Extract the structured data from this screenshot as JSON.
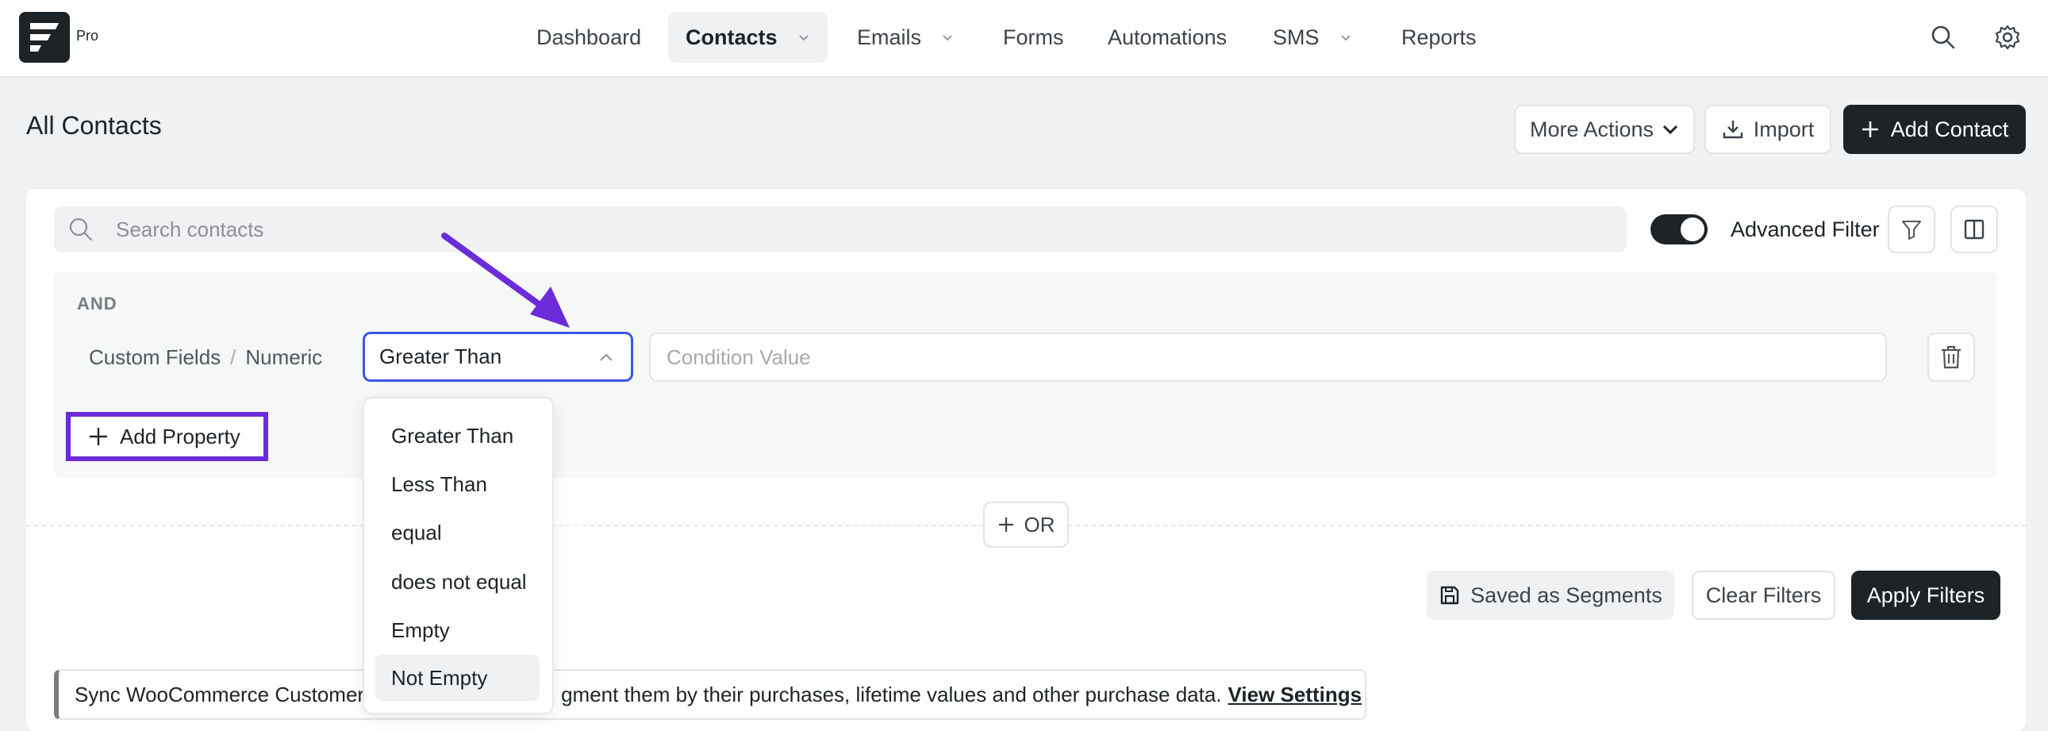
{
  "brand": {
    "badge": "Pro"
  },
  "nav": {
    "dashboard": "Dashboard",
    "contacts": "Contacts",
    "emails": "Emails",
    "forms": "Forms",
    "automations": "Automations",
    "sms": "SMS",
    "reports": "Reports"
  },
  "header": {
    "title": "All Contacts",
    "more_actions": "More Actions",
    "import": "Import",
    "add_contact": "Add Contact"
  },
  "search": {
    "placeholder": "Search contacts"
  },
  "advanced_filter": {
    "label": "Advanced Filter",
    "enabled": true
  },
  "filter_group": {
    "operator_label": "AND",
    "property_path": [
      "Custom Fields",
      "Numeric"
    ],
    "separator": "/",
    "selected_condition": "Greater Than",
    "value_placeholder": "Condition Value",
    "add_property": "Add Property"
  },
  "condition_options": [
    "Greater Than",
    "Less Than",
    "equal",
    "does not equal",
    "Empty",
    "Not Empty"
  ],
  "highlighted_option": "Not Empty",
  "or_button": "OR",
  "actions": {
    "saved_segments": "Saved as Segments",
    "clear_filters": "Clear Filters",
    "apply_filters": "Apply Filters"
  },
  "banner": {
    "text_start": "Sync WooCommerce Customers",
    "text_end": "gment them by their purchases, lifetime values and other purchase data.",
    "link": "View Settings"
  },
  "colors": {
    "dark": "#1d2327",
    "accent_blue": "#3858e9",
    "annotation_purple": "#6c2bd9"
  }
}
